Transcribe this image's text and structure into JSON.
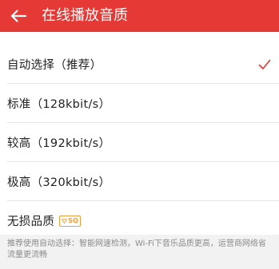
{
  "colors": {
    "accent": "#e53935",
    "badge": "#f29b3a"
  },
  "header": {
    "back_icon": "arrow-left-icon",
    "title": "在线播放音质"
  },
  "options": [
    {
      "label": "自动选择（推荐）",
      "selected": true
    },
    {
      "label": "标准（128kbit/s）",
      "selected": false
    },
    {
      "label": "较高（192kbit/s）",
      "selected": false
    },
    {
      "label": "极高（320kbit/s）",
      "selected": false
    },
    {
      "label": "无损品质",
      "selected": false,
      "badge": "SQ"
    }
  ],
  "footer": {
    "note": "推荐使用自动选择：智能网速检测，Wi-Fi下音乐品质更高，运营商网络省流量更流畅"
  }
}
